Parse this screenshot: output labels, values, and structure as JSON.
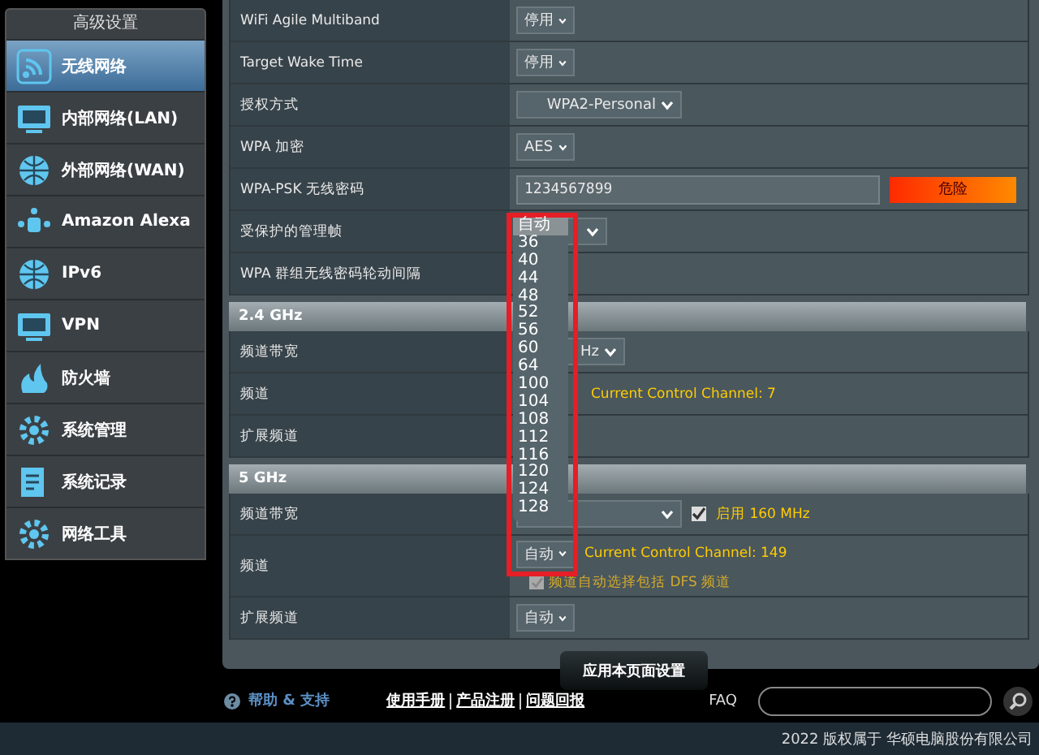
{
  "sidebar": {
    "title": "高级设置",
    "items": [
      {
        "label": "无线网络",
        "selected": true
      },
      {
        "label": "内部网络(LAN)",
        "selected": false
      },
      {
        "label": "外部网络(WAN)",
        "selected": false
      },
      {
        "label": "Amazon Alexa",
        "selected": false
      },
      {
        "label": "IPv6",
        "selected": false
      },
      {
        "label": "VPN",
        "selected": false
      },
      {
        "label": "防火墙",
        "selected": false
      },
      {
        "label": "系统管理",
        "selected": false
      },
      {
        "label": "系统记录",
        "selected": false
      },
      {
        "label": "网络工具",
        "selected": false
      }
    ]
  },
  "general": [
    {
      "label": "WiFi Agile Multiband",
      "kind": "select",
      "value": "停用"
    },
    {
      "label": "Target Wake Time",
      "kind": "select",
      "value": "停用"
    },
    {
      "label": "授权方式",
      "kind": "select",
      "value": "WPA2-Personal"
    },
    {
      "label": "WPA 加密",
      "kind": "select",
      "value": "AES"
    },
    {
      "label": "WPA-PSK 无线密码",
      "kind": "password",
      "value": "1234567899",
      "strength": "危险"
    },
    {
      "label": "受保护的管理帧",
      "kind": "select"
    },
    {
      "label": "WPA 群组无线密码轮动间隔",
      "kind": "blank"
    }
  ],
  "sections": [
    {
      "title": "2.4 GHz",
      "rows": [
        {
          "label": "频道带宽",
          "kind": "select",
          "value": "Hz"
        },
        {
          "label": "频道",
          "kind": "info",
          "note": "Current Control Channel: 7"
        },
        {
          "label": "扩展频道",
          "kind": "blank"
        }
      ]
    },
    {
      "title": "5 GHz",
      "rows": [
        {
          "label": "频道带宽",
          "kind": "select",
          "check": {
            "label": "启用 160 MHz",
            "checked": true
          }
        },
        {
          "label": "频道",
          "kind": "select",
          "value": "自动",
          "note": "Current Control Channel: 149",
          "check2": {
            "label": "频道自动选择包括 DFS 频道",
            "checked": true,
            "disabled": true
          }
        },
        {
          "label": "扩展频道",
          "kind": "select",
          "value": "自动"
        }
      ]
    }
  ],
  "apply_button": "应用本页面设置",
  "dropdown": {
    "options": [
      {
        "label": "自动",
        "selected": true
      },
      {
        "label": "36",
        "selected": false
      },
      {
        "label": "40",
        "selected": false
      },
      {
        "label": "44",
        "selected": false
      },
      {
        "label": "48",
        "selected": false
      },
      {
        "label": "52",
        "selected": false
      },
      {
        "label": "56",
        "selected": false
      },
      {
        "label": "60",
        "selected": false
      },
      {
        "label": "64",
        "selected": false
      },
      {
        "label": "100",
        "selected": false
      },
      {
        "label": "104",
        "selected": false
      },
      {
        "label": "108",
        "selected": false
      },
      {
        "label": "112",
        "selected": false
      },
      {
        "label": "116",
        "selected": false
      },
      {
        "label": "120",
        "selected": false
      },
      {
        "label": "124",
        "selected": false
      },
      {
        "label": "128",
        "selected": false
      }
    ]
  },
  "footer": {
    "help": "帮助 & 支持",
    "links": [
      "使用手册",
      "产品注册",
      "问题回报"
    ],
    "faq": "FAQ",
    "copyright": "2022 版权属于 华硕电脑股份有限公司"
  }
}
